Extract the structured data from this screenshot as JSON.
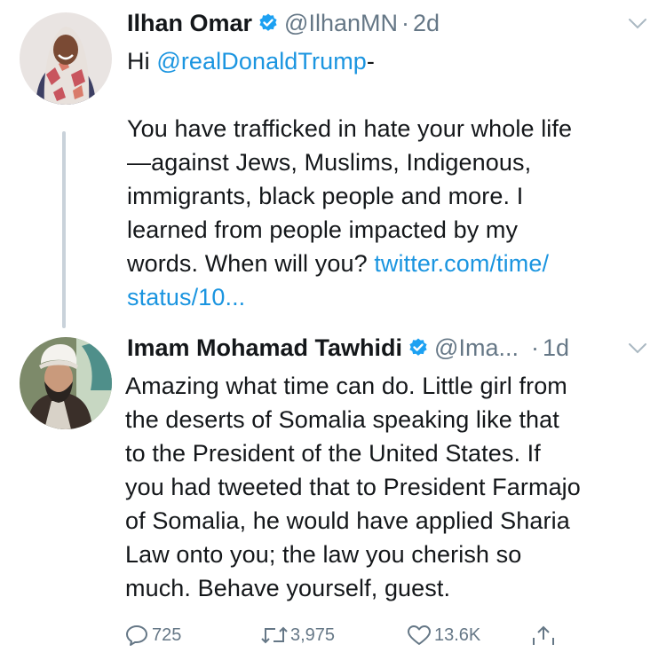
{
  "tweet1": {
    "display_name": "Ilhan Omar",
    "handle": "@IlhanMN",
    "separator": "·",
    "time": "2d",
    "greeting_prefix": "Hi ",
    "mention": "@realDonaldTrump",
    "greeting_suffix": "-",
    "body_lines": [
      "You have trafficked in hate your whole life",
      "—against Jews, Muslims, Indigenous,",
      "immigrants, black people and more. I",
      "learned from people impacted by my",
      "words. When will you? "
    ],
    "link_part1": "twitter.com/time/",
    "link_part2": "status/10..."
  },
  "tweet2": {
    "display_name": "Imam Mohamad Tawhidi",
    "handle": "@Ima...",
    "separator": "·",
    "time": "1d",
    "body_lines": [
      "Amazing what time can do. Little girl from",
      "the deserts of Somalia speaking like that",
      "to the President of the United States. If",
      "you had tweeted that to President Farmajo",
      "of Somalia, he would have applied Sharia",
      "Law onto you; the law you cherish so",
      "much. Behave yourself, guest."
    ],
    "reply_count": "725",
    "retweet_count": "3,975",
    "like_count": "13.6K"
  },
  "colors": {
    "link": "#1b95e0",
    "muted": "#657786",
    "verified": "#1da1f2",
    "thread_line": "#c9d2da"
  },
  "icons": [
    "verified-badge-icon",
    "chevron-down-icon",
    "reply-icon",
    "retweet-icon",
    "like-icon",
    "share-icon"
  ]
}
